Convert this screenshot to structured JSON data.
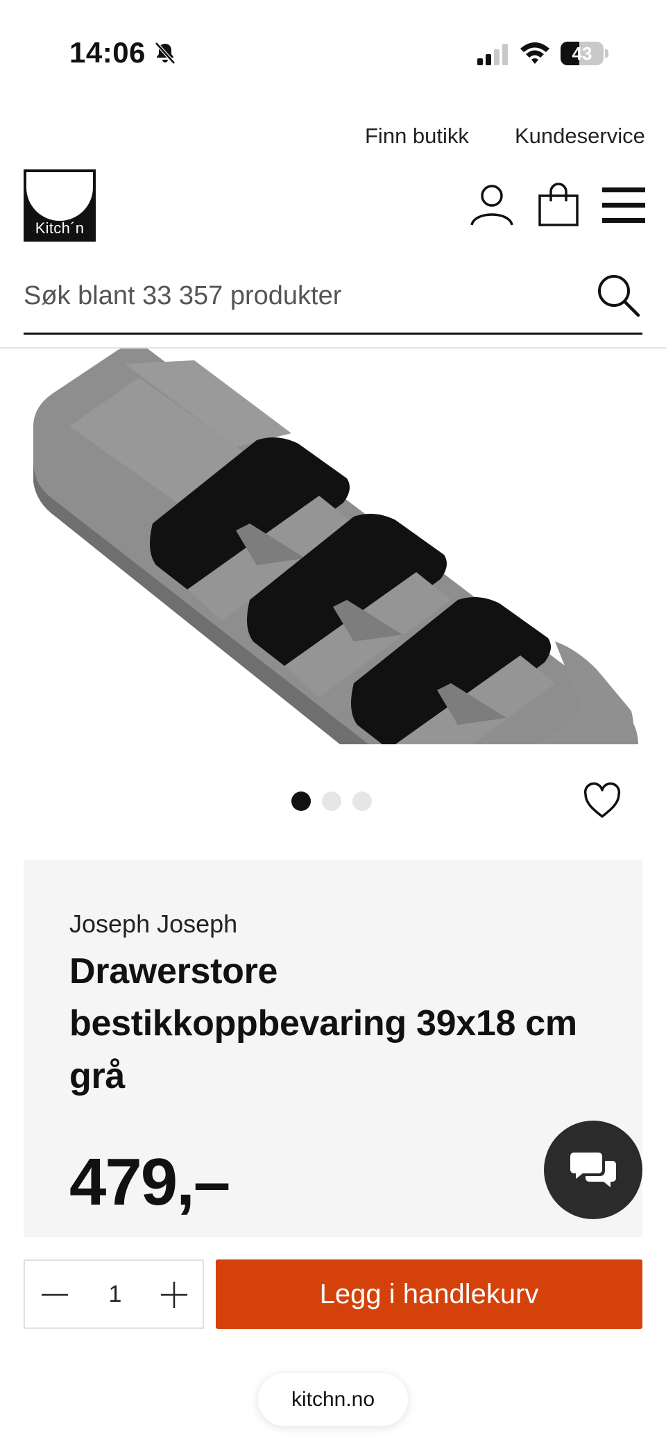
{
  "status_bar": {
    "time": "14:06",
    "battery_level": "43",
    "battery_fraction": 0.43,
    "icons": [
      "bell-slash-icon",
      "cellular-signal-icon",
      "wifi-icon",
      "battery-icon"
    ]
  },
  "top_links": {
    "find_store": "Finn butikk",
    "customer_service": "Kundeservice"
  },
  "header": {
    "logo_text": "Kitch´n",
    "icons": [
      "user-icon",
      "shopping-bag-icon",
      "hamburger-menu-icon"
    ]
  },
  "search": {
    "placeholder": "Søk blant 33 357 produkter",
    "value": ""
  },
  "gallery": {
    "image_count": 3,
    "active_index": 0,
    "image_subject": "grey cutlery drawer organizer"
  },
  "product": {
    "brand": "Joseph Joseph",
    "title": "Drawerstore bestikkoppbevaring 39x18 cm grå",
    "price": "479,–"
  },
  "purchase": {
    "quantity": "1",
    "add_to_cart_label": "Legg i handlekurv"
  },
  "browser": {
    "url": "kitchn.no"
  },
  "colors": {
    "accent": "#d4410b",
    "panel_background": "#f5f5f5",
    "chat_button": "#2b2b2b"
  }
}
